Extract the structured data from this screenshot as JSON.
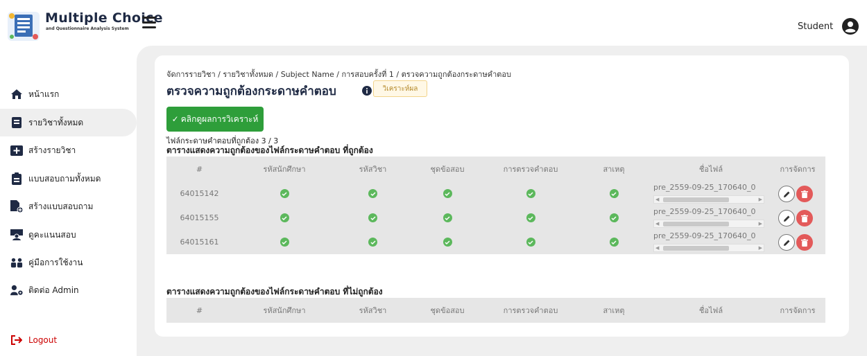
{
  "header": {
    "brand_title": "Multiple Choice",
    "brand_subtitle": "and Questionnaire Analysis System",
    "user_label": "Student"
  },
  "sidebar": {
    "items": [
      {
        "label": "หน้าแรก",
        "icon": "home-icon",
        "active": false
      },
      {
        "label": "รายวิชาทั้งหมด",
        "icon": "book-icon",
        "active": true
      },
      {
        "label": "สร้างรายวิชา",
        "icon": "add-box-icon",
        "active": false
      },
      {
        "label": "แบบสอบถามทั้งหมด",
        "icon": "clipboard-icon",
        "active": false
      },
      {
        "label": "สร้างแบบสอบถาม",
        "icon": "file-add-icon",
        "active": false
      },
      {
        "label": "ดูคะแนนสอบ",
        "icon": "teacher-icon",
        "active": false
      },
      {
        "label": "คู่มือการใช้งาน",
        "icon": "people-icon",
        "active": false
      },
      {
        "label": "ติดต่อ Admin",
        "icon": "user-gear-icon",
        "active": false
      }
    ],
    "logout_label": "Logout"
  },
  "content": {
    "breadcrumb": "จัดการรายวิชา / รายวิชาทั้งหมด / Subject Name / การสอบครั้งที่ 1 / ตรวจความถูกต้องกระดาษคำตอบ",
    "page_title": "ตรวจความถูกต้องกระดาษคำตอบ",
    "analyze_badge": "วิเคราะห์ผล",
    "result_button": "คลิกดูผลการวิเคราะห์",
    "file_count": "ไฟล์กระดาษคำตอบที่ถูกต้อง 3 / 3",
    "correct_table_title": "ตารางแสดงความถูกต้องของไฟล์กระดาษคำตอบ ที่ถูกต้อง",
    "incorrect_table_title": "ตารางแสดงความถูกต้องของไฟล์กระดาษคำตอบ ที่ไม่ถูกต้อง",
    "columns": [
      "#",
      "รหัสนักศึกษา",
      "รหัสวิชา",
      "ชุดข้อสอบ",
      "การตรวจคำตอบ",
      "สาเหตุ",
      "ชื่อไฟล์",
      "การจัดการ"
    ],
    "correct_rows": [
      {
        "id": "64015142",
        "filename": "pre_2559-09-25_170640_0"
      },
      {
        "id": "64015155",
        "filename": "pre_2559-09-25_170640_0"
      },
      {
        "id": "64015161",
        "filename": "pre_2559-09-25_170640_0"
      }
    ]
  },
  "colors": {
    "accent_green": "#2e9e3a",
    "check_green": "#5cb85c",
    "delete_red": "#e35a5a",
    "logout_red": "#cc0000"
  }
}
